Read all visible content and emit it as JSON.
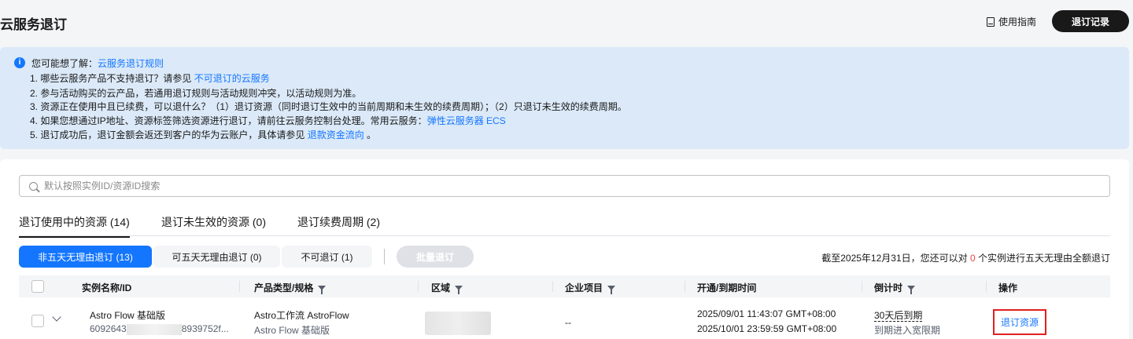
{
  "header": {
    "title": "云服务退订",
    "guide_label": "使用指南",
    "records_label": "退订记录"
  },
  "notice": {
    "intro": "您可能想了解：",
    "intro_link": "云服务退订规则",
    "line1_text": "1. 哪些云服务产品不支持退订？请参见 ",
    "line1_link": "不可退订的云服务",
    "line2_text": "2. 参与活动购买的云产品，若通用退订规则与活动规则冲突，以活动规则为准。",
    "line3_text": "3. 资源正在使用中且已续费，可以退什么？（1）退订资源（同时退订生效中的当前周期和未生效的续费周期）；（2）只退订未生效的续费周期。",
    "line4_text": "4. 如果您想通过IP地址、资源标签筛选资源进行退订，请前往云服务控制台处理。常用云服务：",
    "line4_link": "弹性云服务器 ECS",
    "line5_text": "5. 退订成功后，退订金额会返还到客户的华为云账户，具体请参见 ",
    "line5_link": "退款资金流向",
    "line5_end": " 。"
  },
  "search": {
    "placeholder": "默认按照实例ID/资源ID搜索"
  },
  "tabs": [
    {
      "label": "退订使用中的资源 (14)"
    },
    {
      "label": "退订未生效的资源 (0)"
    },
    {
      "label": "退订续费周期 (2)"
    }
  ],
  "filters": [
    {
      "label": "非五天无理由退订 (13)"
    },
    {
      "label": "可五天无理由退订 (0)"
    },
    {
      "label": "不可退订 (1)"
    }
  ],
  "batch_label": "批量退订",
  "quota": {
    "prefix": "截至2025年12月31日，您还可以对 ",
    "count": "0",
    "suffix": " 个实例进行五天无理由全额退订"
  },
  "columns": {
    "name": "实例名称/ID",
    "product": "产品类型/规格",
    "region": "区域",
    "project": "企业项目",
    "time": "开通/到期时间",
    "countdown": "倒计时",
    "action": "操作"
  },
  "rows": [
    {
      "name": "Astro Flow 基础版",
      "id_prefix": "6092643",
      "id_suffix": "8939752f...",
      "product": "Astro工作流 AstroFlow",
      "spec": "Astro Flow 基础版",
      "project": "--",
      "start": "2025/09/01 11:43:07 GMT+08:00",
      "end": "2025/10/01 23:59:59 GMT+08:00",
      "countdown": "30天后到期",
      "countdown_sub": "到期进入宽限期",
      "action": "退订资源"
    }
  ],
  "colors": {
    "accent": "#1476ff",
    "notice_bg": "#dbe9f8",
    "highlight": "#e02020"
  }
}
